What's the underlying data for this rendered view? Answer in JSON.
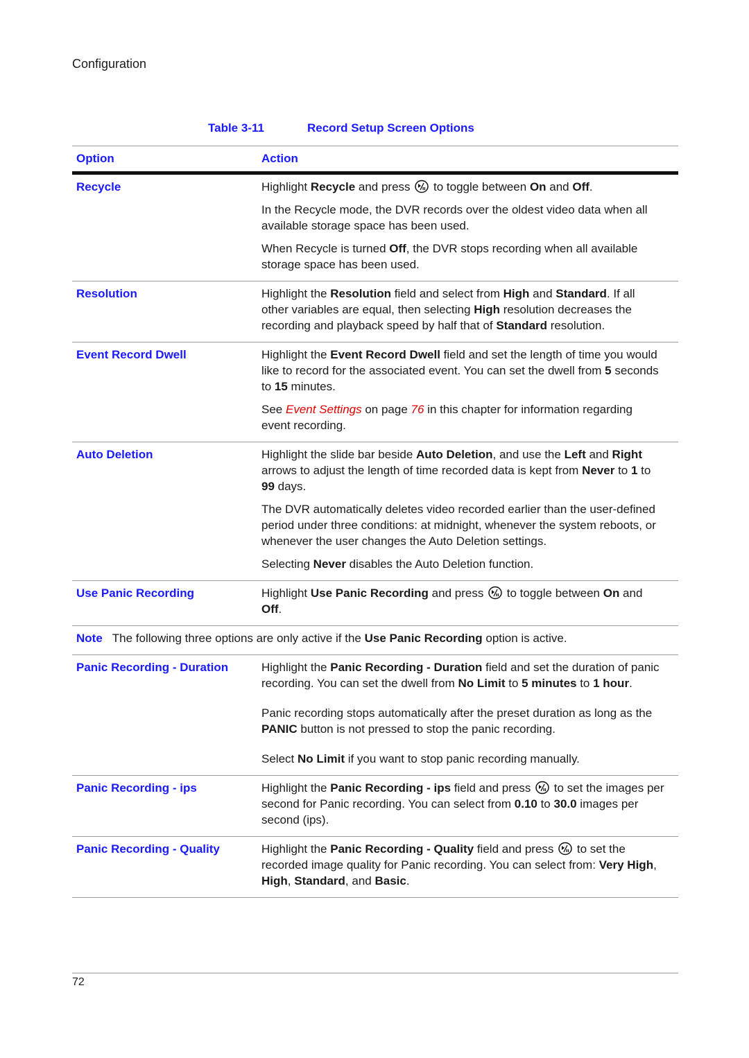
{
  "header": {
    "section": "Configuration"
  },
  "table": {
    "number": "Table 3-11",
    "title": "Record Setup Screen Options",
    "col_option": "Option",
    "col_action": "Action"
  },
  "icons": {
    "select_button": "play-pause-select-icon"
  },
  "rows": {
    "recycle": {
      "option": "Recycle",
      "p1": {
        "a": "Highlight ",
        "b": "Recycle",
        "c": " and press ",
        "d": " to toggle between ",
        "e": "On",
        "f": " and ",
        "g": "Off",
        "h": "."
      },
      "p2": "In the Recycle mode, the DVR records over the oldest video data when all available storage space has been used.",
      "p3": {
        "a": "When Recycle is turned ",
        "b": "Off",
        "c": ", the DVR stops recording when all available storage space has been used."
      }
    },
    "resolution": {
      "option": "Resolution",
      "p1": {
        "a": "Highlight the ",
        "b": "Resolution",
        "c": " field and select from ",
        "d": "High",
        "e": " and ",
        "f": "Standard",
        "g": ". If all other variables are equal, then selecting ",
        "h": "High",
        "i": " resolution decreases the recording and playback speed by half that of ",
        "j": "Standard",
        "k": " resolution."
      }
    },
    "event_dwell": {
      "option": "Event Record Dwell",
      "p1": {
        "a": "Highlight the ",
        "b": "Event Record Dwell",
        "c": " field and set the length of time you would like to record for the associated event. You can set the dwell from ",
        "d": "5",
        "e": " seconds to ",
        "f": "15",
        "g": " minutes."
      },
      "p2": {
        "a": "See ",
        "link": "Event Settings",
        "b": " on page ",
        "page": "76",
        "c": " in this chapter for information regarding event recording."
      }
    },
    "auto_deletion": {
      "option": "Auto Deletion",
      "p1": {
        "a": "Highlight the slide bar beside ",
        "b": "Auto Deletion",
        "c": ", and use the ",
        "d": "Left",
        "e": " and ",
        "f": "Right",
        "g": " arrows to adjust the length of time recorded data is kept from ",
        "h": "Never",
        "i": " to ",
        "j": "1",
        "k": " to ",
        "l": "99",
        "m": " days."
      },
      "p2": "The DVR automatically deletes video recorded earlier than the user-defined period under three conditions: at midnight, whenever the system reboots, or whenever the user changes the Auto Deletion settings.",
      "p3": {
        "a": "Selecting ",
        "b": "Never",
        "c": " disables the Auto Deletion function."
      }
    },
    "use_panic": {
      "option": "Use Panic Recording",
      "p1": {
        "a": "Highlight ",
        "b": "Use Panic Recording",
        "c": " and press ",
        "d": " to toggle between ",
        "e": "On",
        "f": " and ",
        "g": "Off",
        "h": "."
      }
    },
    "note": {
      "label": "Note",
      "a": "The following three options are only active if the ",
      "b": "Use Panic Recording",
      "c": " option is active."
    },
    "panic_duration": {
      "option": "Panic Recording - Duration",
      "p1": {
        "a": "Highlight the ",
        "b": "Panic Recording - Duration",
        "c": " field and set the duration of panic recording. You can set the dwell from ",
        "d": "No Limit",
        "e": " to ",
        "f": "5 minutes",
        "g": " to ",
        "h": "1 hour",
        "i": "."
      },
      "p2": {
        "a": "Panic recording stops automatically after the preset duration as long as the ",
        "b": "PANIC",
        "c": " button is not pressed to stop the panic recording."
      },
      "p3": {
        "a": "Select ",
        "b": "No Limit",
        "c": " if you want to stop panic recording manually."
      }
    },
    "panic_ips": {
      "option": "Panic Recording - ips",
      "p1": {
        "a": "Highlight the ",
        "b": "Panic Recording - ips",
        "c": " field and press ",
        "d": " to set the images per second for Panic recording. You can select from ",
        "e": "0.10",
        "f": " to ",
        "g": "30.0",
        "h": " images per second (ips)."
      }
    },
    "panic_quality": {
      "option": "Panic Recording - Quality",
      "p1": {
        "a": "Highlight the ",
        "b": "Panic Recording - Quality",
        "c": " field and press ",
        "d": " to set the recorded image quality for Panic recording. You can select from: ",
        "e": "Very High",
        "f": ", ",
        "g": "High",
        "h": ", ",
        "i": "Standard",
        "j": ", and ",
        "k": "Basic",
        "l": "."
      }
    }
  },
  "footer": {
    "page_number": "72"
  }
}
